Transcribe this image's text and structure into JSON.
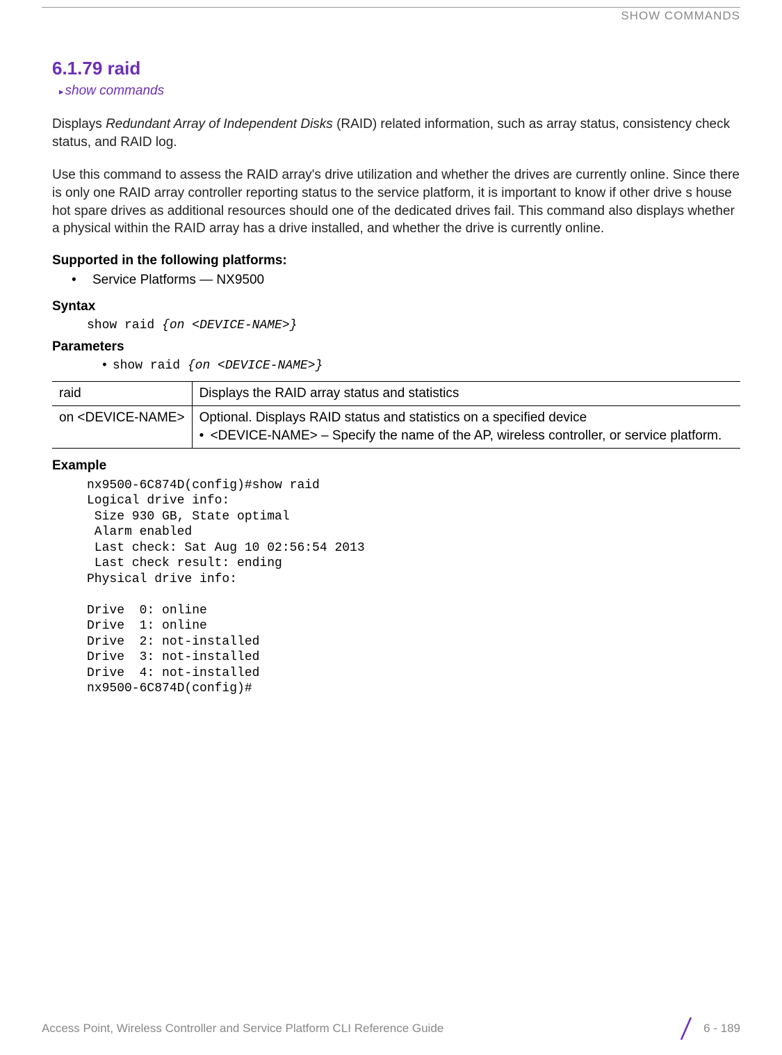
{
  "header": {
    "section_label": "SHOW COMMANDS"
  },
  "heading": {
    "number_title": "6.1.79 raid",
    "breadcrumb": "show commands"
  },
  "intro": {
    "para1_prefix": "Displays ",
    "para1_italic": "Redundant Array of Independent Disks",
    "para1_suffix": " (RAID) related information, such as array status, consistency check status, and RAID log.",
    "para2": "Use this command to assess the RAID array's drive utilization and whether the drives are currently online. Since there is only one RAID array controller reporting status to the service platform, it is important to know if other drive s house hot spare drives as additional resources should one of the dedicated drives fail. This command also displays whether a physical within the RAID array has a drive installed, and whether the drive is currently online."
  },
  "supported": {
    "heading": "Supported in the following platforms:",
    "item": "Service Platforms — NX9500"
  },
  "syntax": {
    "heading": "Syntax",
    "cmd_plain": "show raid ",
    "cmd_italic": "{on <DEVICE-NAME>}"
  },
  "parameters": {
    "heading": "Parameters",
    "list_plain": "show raid ",
    "list_italic": "{on <DEVICE-NAME>}",
    "rows": [
      {
        "name": "raid",
        "desc": "Displays the RAID array status and statistics"
      },
      {
        "name": "on <DEVICE-NAME>",
        "desc": "Optional. Displays RAID status and statistics on a specified device",
        "sub": "<DEVICE-NAME> – Specify the name of the AP, wireless controller, or service platform."
      }
    ]
  },
  "example": {
    "heading": "Example",
    "text": "nx9500-6C874D(config)#show raid\nLogical drive info:\n Size 930 GB, State optimal\n Alarm enabled\n Last check: Sat Aug 10 02:56:54 2013\n Last check result: ending\nPhysical drive info:\n\nDrive  0: online\nDrive  1: online\nDrive  2: not-installed\nDrive  3: not-installed\nDrive  4: not-installed\nnx9500-6C874D(config)#"
  },
  "footer": {
    "left": "Access Point, Wireless Controller and Service Platform CLI Reference Guide",
    "page": "6 - 189"
  }
}
